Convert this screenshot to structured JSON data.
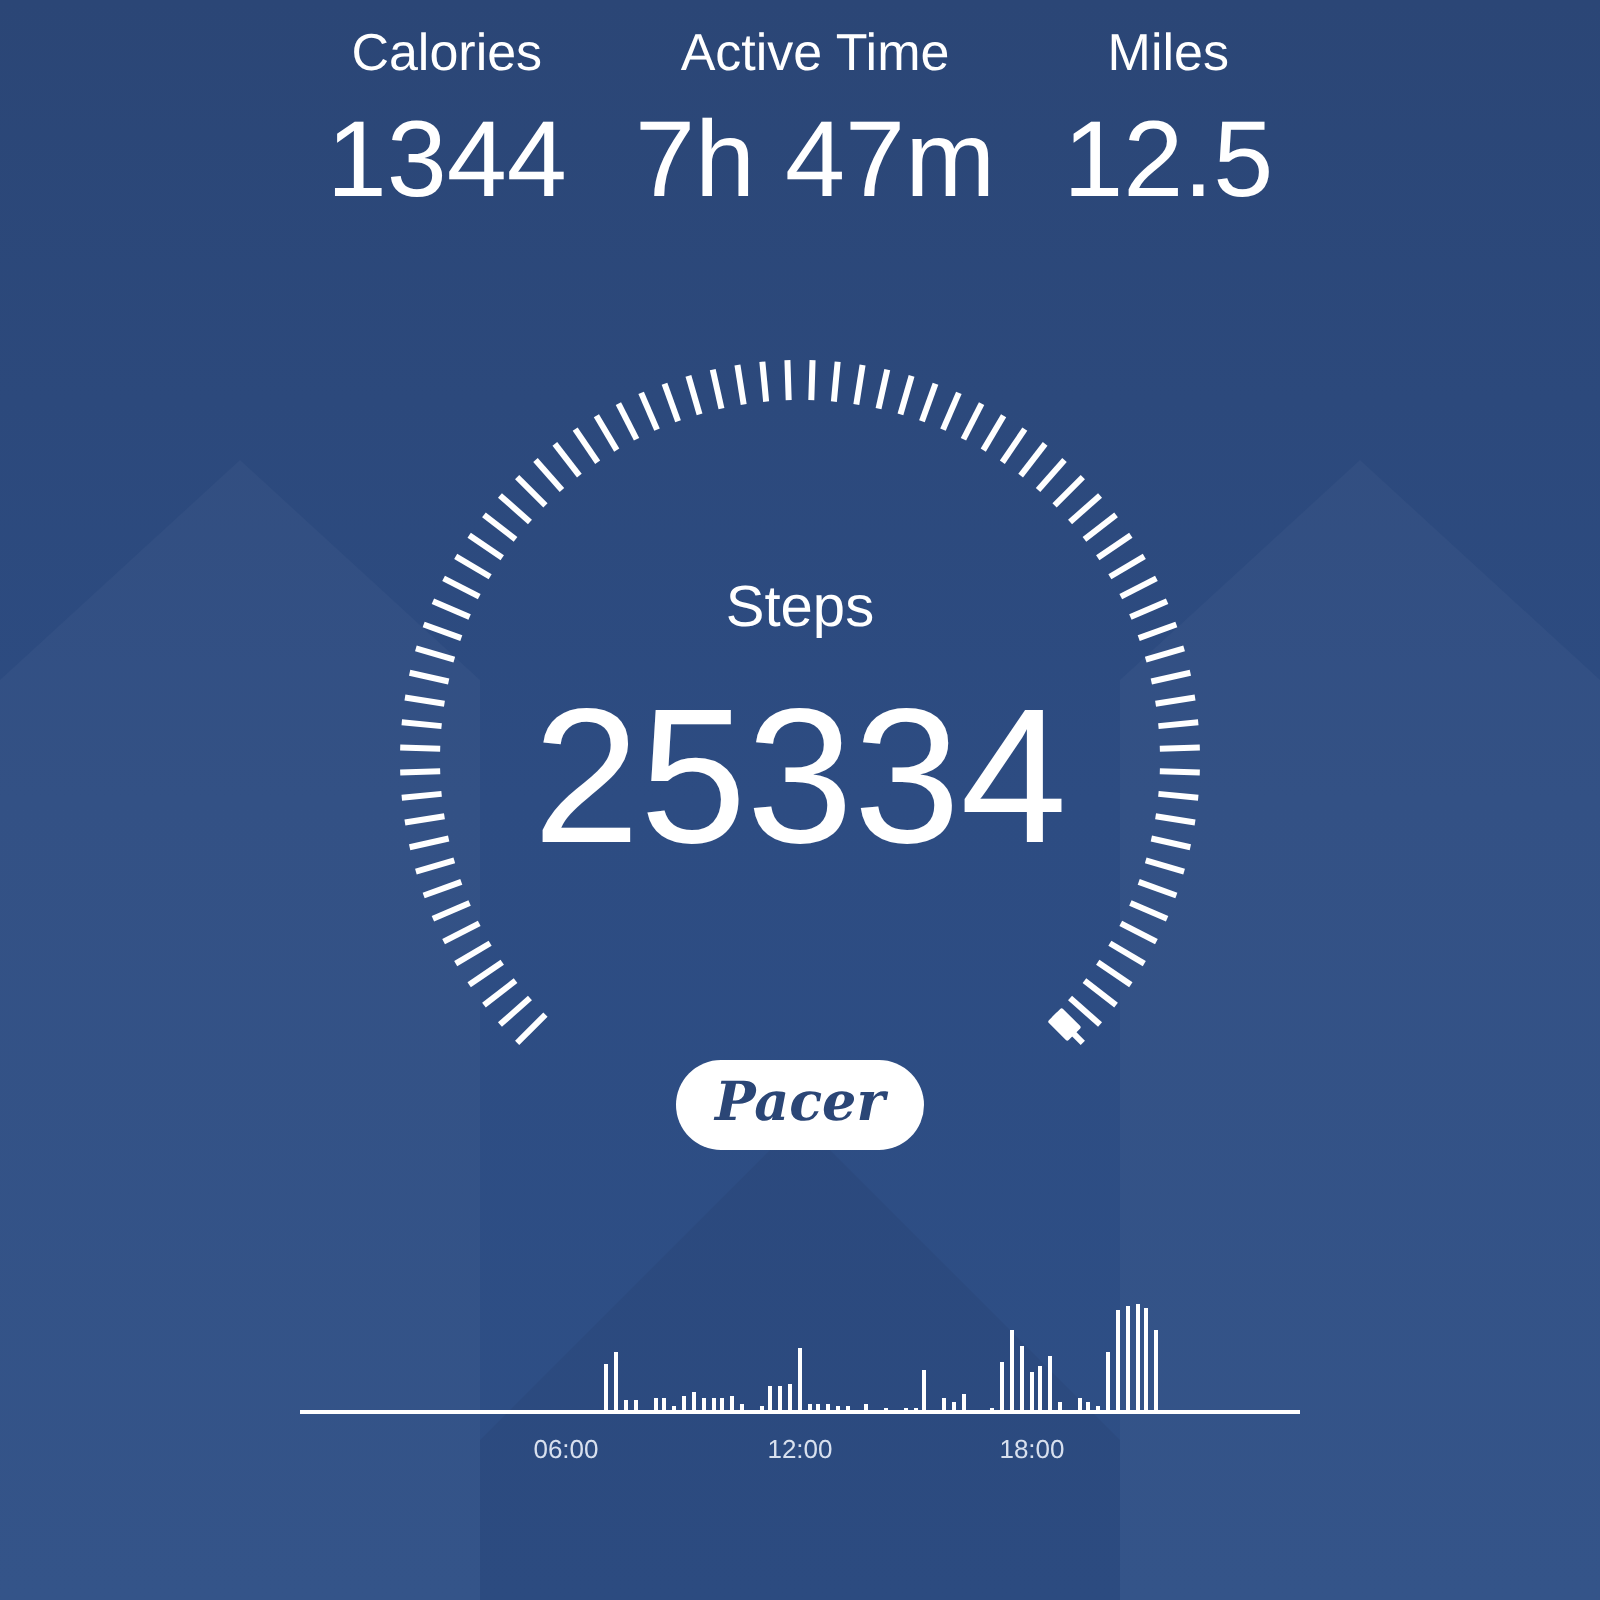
{
  "stats": [
    {
      "label": "Calories",
      "value": "1344"
    },
    {
      "label": "Active Time",
      "value": "7h 47m"
    },
    {
      "label": "Miles",
      "value": "12.5"
    }
  ],
  "steps": {
    "label": "Steps",
    "value": "25334"
  },
  "brand": "Pacer",
  "activity_chart": {
    "time_labels": [
      "06:00",
      "12:00",
      "18:00"
    ]
  }
}
